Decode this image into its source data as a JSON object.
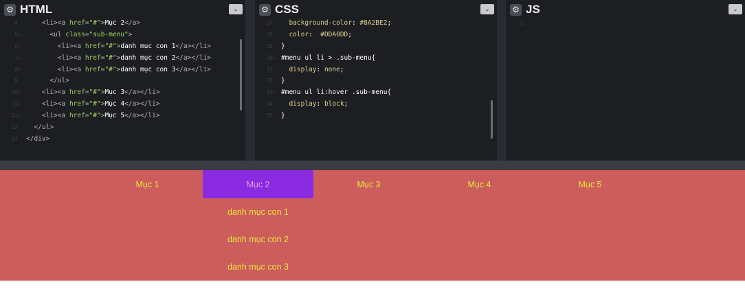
{
  "panels": {
    "html": {
      "title": "HTML",
      "gear_icon": "⚙",
      "chevron_icon": "⌄"
    },
    "css": {
      "title": "CSS",
      "gear_icon": "⚙",
      "chevron_icon": "⌄"
    },
    "js": {
      "title": "JS",
      "gear_icon": "⚙",
      "chevron_icon": "⌄"
    }
  },
  "html_code": [
    {
      "n": "4",
      "fold": "",
      "indent": "    ",
      "parts": [
        [
          "t-tag",
          "<li><a "
        ],
        [
          "t-attr",
          "href"
        ],
        [
          "t-tag",
          "="
        ],
        [
          "t-str",
          "\"#\""
        ],
        [
          "t-tag",
          ">"
        ],
        [
          "t-txt",
          "Mục 2"
        ],
        [
          "t-tag",
          "</a>"
        ]
      ]
    },
    {
      "n": "5",
      "fold": "▾",
      "indent": "      ",
      "parts": [
        [
          "t-tag",
          "<ul "
        ],
        [
          "t-attr",
          "class"
        ],
        [
          "t-tag",
          "="
        ],
        [
          "t-str",
          "\"sub-menu\""
        ],
        [
          "t-tag",
          ">"
        ]
      ]
    },
    {
      "n": "6",
      "fold": "▾",
      "indent": "        ",
      "parts": [
        [
          "t-tag",
          "<li><a "
        ],
        [
          "t-attr",
          "href"
        ],
        [
          "t-tag",
          "="
        ],
        [
          "t-str",
          "\"#\""
        ],
        [
          "t-tag",
          ">"
        ],
        [
          "t-txt",
          "danh mục con 1"
        ],
        [
          "t-tag",
          "</a></li>"
        ]
      ]
    },
    {
      "n": "7",
      "fold": "▾",
      "indent": "        ",
      "parts": [
        [
          "t-tag",
          "<li><a "
        ],
        [
          "t-attr",
          "href"
        ],
        [
          "t-tag",
          "="
        ],
        [
          "t-str",
          "\"#\""
        ],
        [
          "t-tag",
          ">"
        ],
        [
          "t-txt",
          "danh mục con 2"
        ],
        [
          "t-tag",
          "</a></li>"
        ]
      ]
    },
    {
      "n": "8",
      "fold": "▾",
      "indent": "        ",
      "parts": [
        [
          "t-tag",
          "<li><a "
        ],
        [
          "t-attr",
          "href"
        ],
        [
          "t-tag",
          "="
        ],
        [
          "t-str",
          "\"#\""
        ],
        [
          "t-tag",
          ">"
        ],
        [
          "t-txt",
          "danh mục con 3"
        ],
        [
          "t-tag",
          "</a></li>"
        ]
      ]
    },
    {
      "n": "9",
      "fold": "",
      "indent": "      ",
      "parts": [
        [
          "t-tag",
          "</ul>"
        ]
      ]
    },
    {
      "n": "10",
      "fold": "▾",
      "indent": "    ",
      "parts": [
        [
          "t-tag",
          "<li><a "
        ],
        [
          "t-attr",
          "href"
        ],
        [
          "t-tag",
          "="
        ],
        [
          "t-str",
          "\"#\""
        ],
        [
          "t-tag",
          ">"
        ],
        [
          "t-txt",
          "Mục 3"
        ],
        [
          "t-tag",
          "</a></li>"
        ]
      ]
    },
    {
      "n": "11",
      "fold": "▾",
      "indent": "    ",
      "parts": [
        [
          "t-tag",
          "<li><a "
        ],
        [
          "t-attr",
          "href"
        ],
        [
          "t-tag",
          "="
        ],
        [
          "t-str",
          "\"#\""
        ],
        [
          "t-tag",
          ">"
        ],
        [
          "t-txt",
          "Mục 4"
        ],
        [
          "t-tag",
          "</a></li>"
        ]
      ]
    },
    {
      "n": "12",
      "fold": "▾",
      "indent": "    ",
      "parts": [
        [
          "t-tag",
          "<li><a "
        ],
        [
          "t-attr",
          "href"
        ],
        [
          "t-tag",
          "="
        ],
        [
          "t-str",
          "\"#\""
        ],
        [
          "t-tag",
          ">"
        ],
        [
          "t-txt",
          "Mục 5"
        ],
        [
          "t-tag",
          "</a></li>"
        ]
      ]
    },
    {
      "n": "13",
      "fold": "",
      "indent": "  ",
      "parts": [
        [
          "t-tag",
          "</ul>"
        ]
      ]
    },
    {
      "n": "14",
      "fold": "",
      "indent": "",
      "parts": [
        [
          "t-tag",
          "</div>"
        ]
      ]
    }
  ],
  "css_code": [
    {
      "n": "27",
      "fold": "",
      "indent": "  ",
      "parts": [
        [
          "c-prop",
          "background-color"
        ],
        [
          "c-val",
          ": "
        ],
        [
          "c-prop",
          "#8A2BE2"
        ],
        [
          "c-val",
          ";"
        ]
      ]
    },
    {
      "n": "28",
      "fold": "",
      "indent": "  ",
      "parts": [
        [
          "c-prop",
          "color"
        ],
        [
          "c-val",
          ":  "
        ],
        [
          "c-prop",
          "#DDA0DD"
        ],
        [
          "c-val",
          ";"
        ]
      ]
    },
    {
      "n": "29",
      "fold": "",
      "indent": "",
      "parts": [
        [
          "c-val",
          "}"
        ]
      ]
    },
    {
      "n": "30",
      "fold": "▾",
      "indent": "",
      "parts": [
        [
          "c-sel",
          "#menu ul li > .sub-menu{"
        ]
      ]
    },
    {
      "n": "31",
      "fold": "",
      "indent": "  ",
      "parts": [
        [
          "c-prop",
          "display"
        ],
        [
          "c-val",
          ": "
        ],
        [
          "c-prop",
          "none"
        ],
        [
          "c-val",
          ";"
        ]
      ]
    },
    {
      "n": "32",
      "fold": "",
      "indent": "",
      "parts": [
        [
          "c-val",
          "}"
        ]
      ]
    },
    {
      "n": "33",
      "fold": "▾",
      "indent": "",
      "parts": [
        [
          "c-sel",
          "#menu ul li:hover .sub-menu{"
        ]
      ]
    },
    {
      "n": "34",
      "fold": "",
      "indent": "  ",
      "parts": [
        [
          "c-prop",
          "display"
        ],
        [
          "c-val",
          ": "
        ],
        [
          "c-prop",
          "block"
        ],
        [
          "c-val",
          ";"
        ]
      ]
    },
    {
      "n": "35",
      "fold": "",
      "indent": "",
      "parts": [
        [
          "c-val",
          "}"
        ]
      ]
    }
  ],
  "js_code": [
    {
      "n": "1",
      "fold": "",
      "indent": "",
      "parts": []
    }
  ],
  "preview": {
    "menu": [
      "Mục 1",
      "Mục 2",
      "Mục 3",
      "Mục 4",
      "Mục 5"
    ],
    "active_index": 1,
    "submenu": [
      "danh mục con 1",
      "danh mục con 2",
      "danh mục con 3"
    ],
    "colors": {
      "background": "#CD5C5C",
      "active_bg": "#8A2BE2",
      "active_text": "#DDA0DD",
      "link": "#E3E838"
    }
  }
}
